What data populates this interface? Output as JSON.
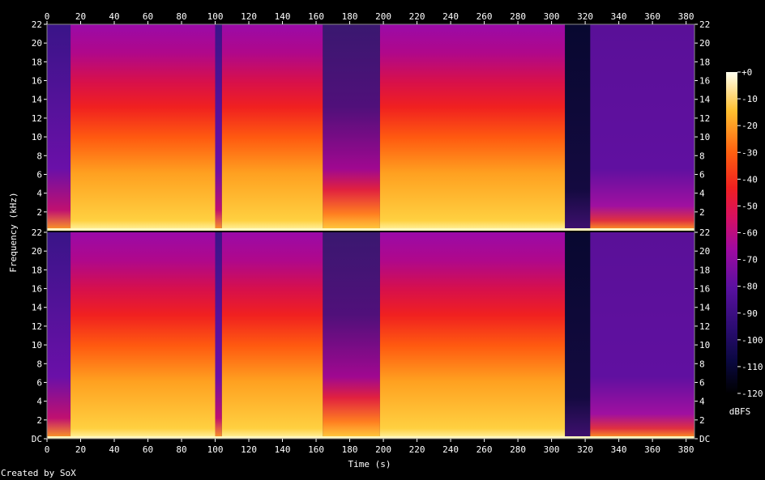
{
  "chart_data": {
    "type": "heatmap",
    "title": "",
    "xlabel": "Time (s)",
    "ylabel": "Frequency (kHz)",
    "xlim": [
      0,
      385
    ],
    "ylim": [
      0,
      22
    ],
    "x_ticks": [
      "0",
      "20",
      "40",
      "60",
      "80",
      "100",
      "120",
      "140",
      "160",
      "180",
      "200",
      "220",
      "240",
      "260",
      "280",
      "300",
      "320",
      "340",
      "360",
      "380"
    ],
    "y_ticks": [
      "DC",
      "2",
      "4",
      "6",
      "8",
      "10",
      "12",
      "14",
      "16",
      "18",
      "20",
      "22"
    ],
    "channels": 2,
    "colorbar": {
      "label": "dBFS",
      "range": [
        -120,
        0
      ],
      "ticks": [
        "+0",
        "-10",
        "-20",
        "-30",
        "-40",
        "-50",
        "-60",
        "-70",
        "-80",
        "-90",
        "-100",
        "-110",
        "-120"
      ]
    },
    "segments": [
      {
        "t0": 0,
        "t1": 14,
        "level": "quiet"
      },
      {
        "t0": 14,
        "t1": 100,
        "level": "loud"
      },
      {
        "t0": 100,
        "t1": 104,
        "level": "quiet"
      },
      {
        "t0": 104,
        "t1": 164,
        "level": "loud"
      },
      {
        "t0": 164,
        "t1": 198,
        "level": "mid"
      },
      {
        "t0": 198,
        "t1": 308,
        "level": "loud"
      },
      {
        "t0": 308,
        "t1": 323,
        "level": "silent"
      },
      {
        "t0": 323,
        "t1": 385,
        "level": "fade"
      }
    ],
    "credit": "Created by SoX"
  }
}
